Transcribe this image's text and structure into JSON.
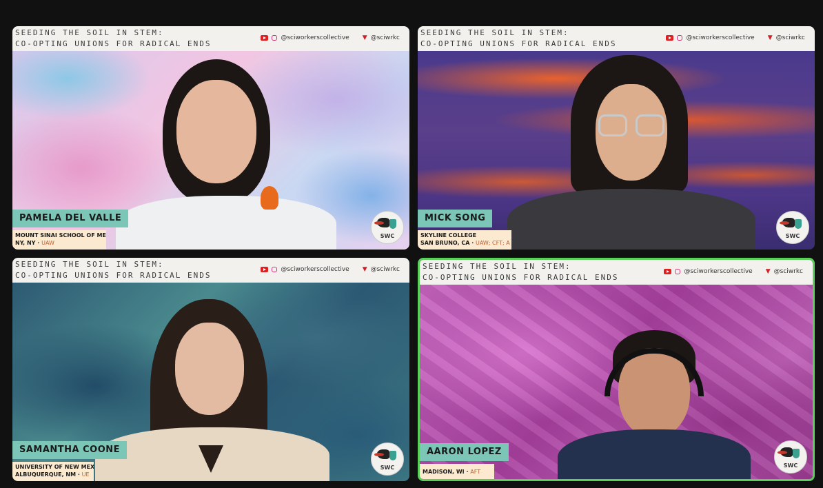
{
  "banner": {
    "line1": "SEEDING THE SOIL IN STEM:",
    "line2": "CO-OPTING UNIONS FOR RADICAL ENDS",
    "youtube_instagram": "@sciworkerscollective",
    "twitter": "@sciwrkc"
  },
  "logo_text": "SWC",
  "participants": [
    {
      "name": "PAMELA DEL VALLE",
      "affil_line1": "MOUNT SINAI SCHOOL OF MEDIC",
      "affil_line2": "NY, NY",
      "affil_union": "UAW",
      "active_speaker": false
    },
    {
      "name": "MICK SONG",
      "affil_line1": "SKYLINE COLLEGE",
      "affil_line2": "SAN BRUNO, CA",
      "affil_union": "UAW; CFT; A",
      "active_speaker": false
    },
    {
      "name": "SAMANTHA COONE",
      "affil_line1": "UNIVERSITY OF NEW MEXI",
      "affil_line2": "ALBUQUERQUE, NM",
      "affil_union": "UE",
      "active_speaker": false
    },
    {
      "name": "AARON LOPEZ",
      "affil_line1": "",
      "affil_line2": "MADISON, WI",
      "affil_union": "AFT",
      "active_speaker": true
    }
  ],
  "colors": {
    "background": "#111111",
    "active_border": "#5bd15b",
    "nameplate": "#7cc6b8",
    "affiliation_plate": "#fbead0"
  }
}
